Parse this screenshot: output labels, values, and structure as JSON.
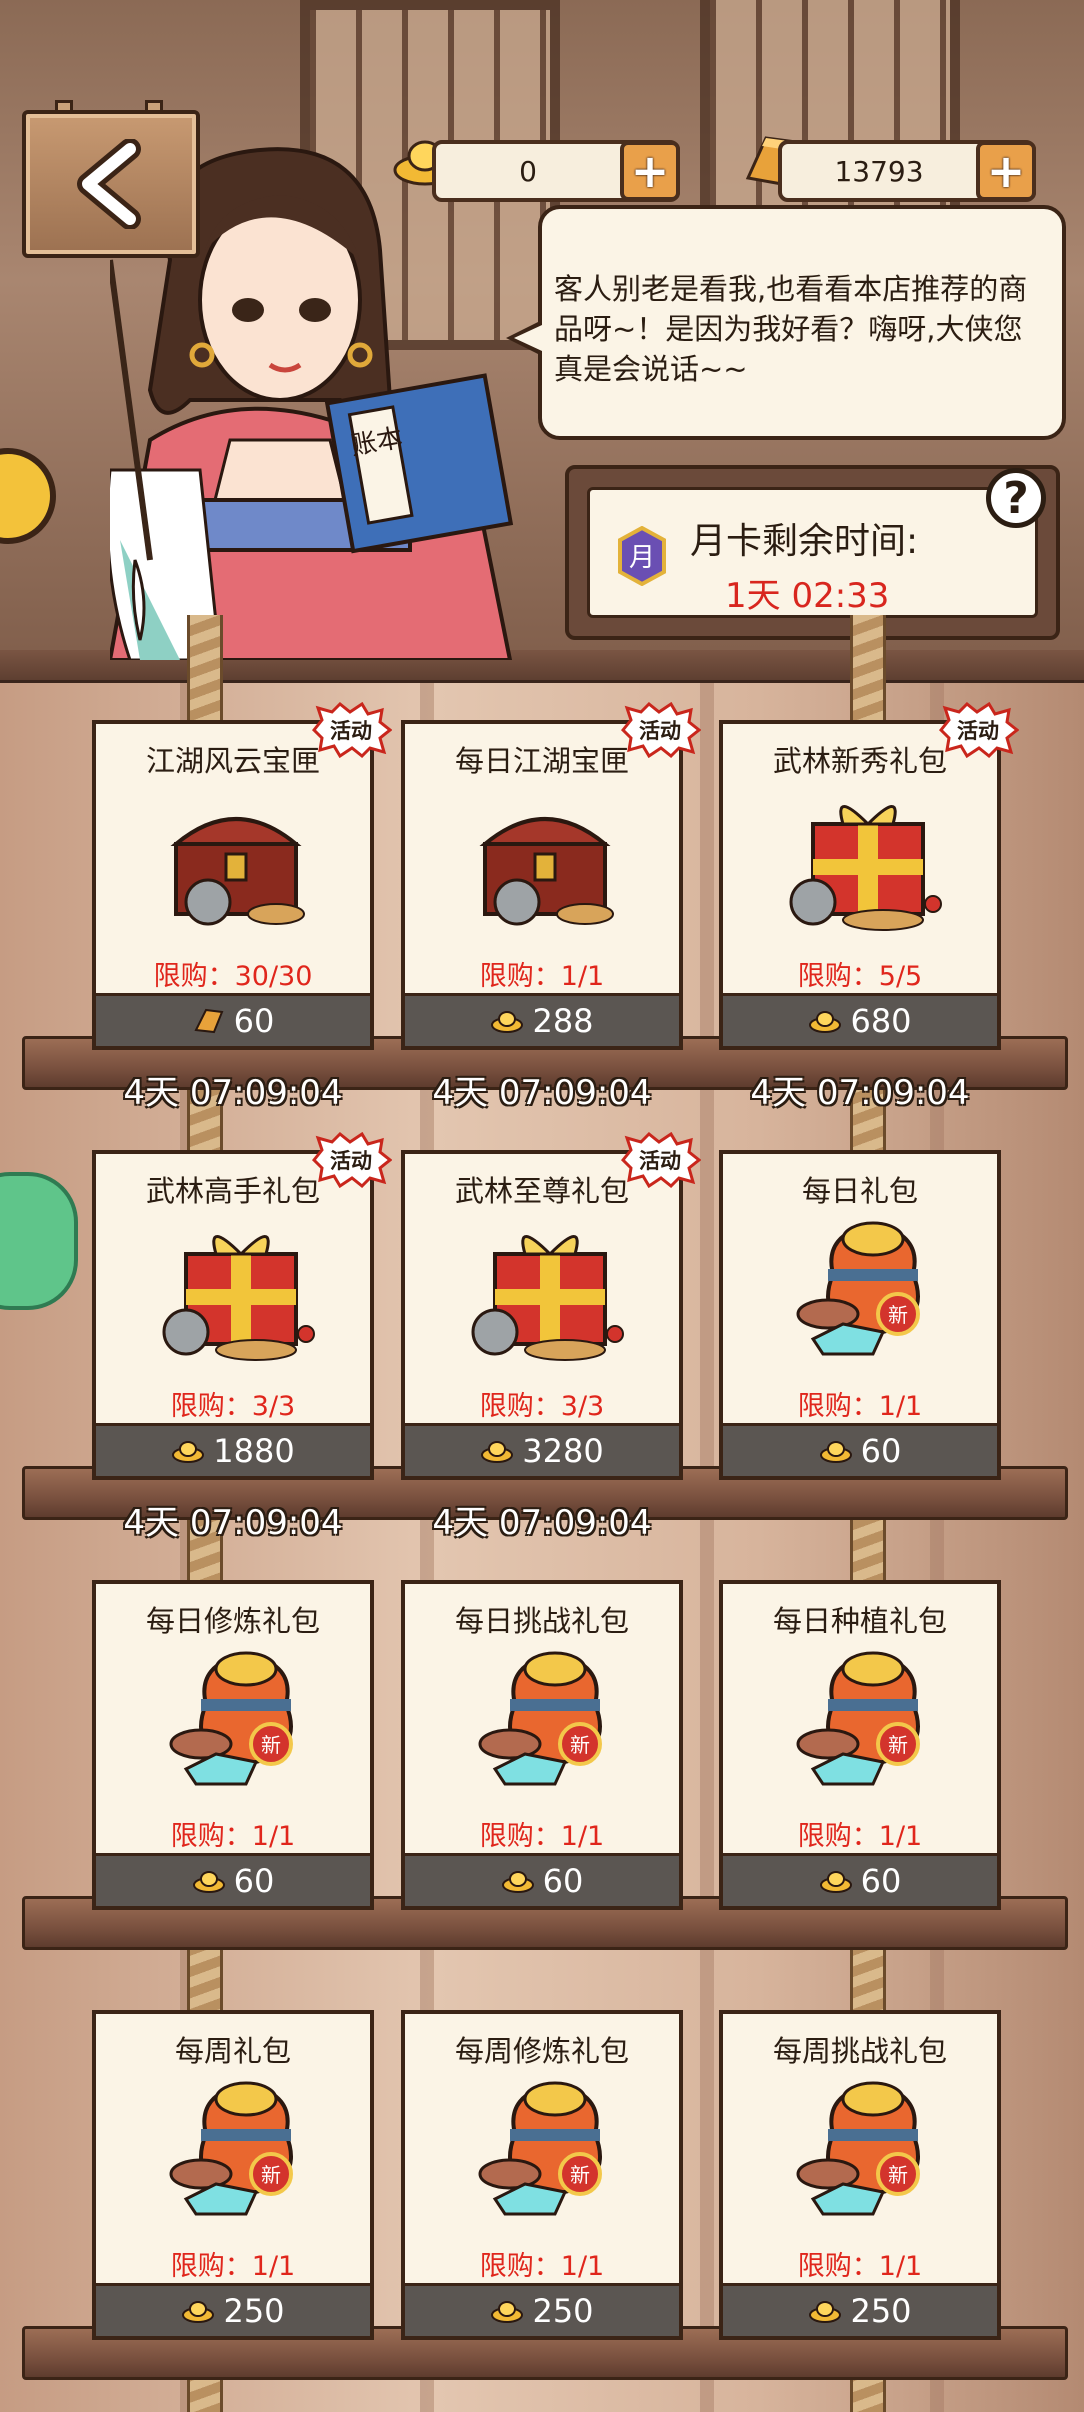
{
  "currencies": {
    "gold": {
      "value": "0",
      "icon": "gold-ingot-icon"
    },
    "bar": {
      "value": "13793",
      "icon": "gold-bar-icon"
    }
  },
  "speech": {
    "text": "客人别老是看我,也看看本店推荐的商品呀~！是因为我好看？嗨呀,大侠您真是会说话~~"
  },
  "month_card": {
    "label": "月卡剩余时间:",
    "time": "1天 02:33"
  },
  "help": {
    "label": "?"
  },
  "badge_text": "活动",
  "items": [
    {
      "name": "江湖风云宝匣",
      "limit": "限购：30/30",
      "price": "60",
      "currency": "bar",
      "timer": "4天 07:09:04",
      "badge": true,
      "art": "chest"
    },
    {
      "name": "每日江湖宝匣",
      "limit": "限购：1/1",
      "price": "288",
      "currency": "gold",
      "timer": "4天 07:09:04",
      "badge": true,
      "art": "chest"
    },
    {
      "name": "武林新秀礼包",
      "limit": "限购：5/5",
      "price": "680",
      "currency": "gold",
      "timer": "4天 07:09:04",
      "badge": true,
      "art": "giftbox"
    },
    {
      "name": "武林高手礼包",
      "limit": "限购：3/3",
      "price": "1880",
      "currency": "gold",
      "timer": "4天 07:09:04",
      "badge": true,
      "art": "giftbox"
    },
    {
      "name": "武林至尊礼包",
      "limit": "限购：3/3",
      "price": "3280",
      "currency": "gold",
      "timer": "4天 07:09:04",
      "badge": true,
      "art": "giftbox"
    },
    {
      "name": "每日礼包",
      "limit": "限购：1/1",
      "price": "60",
      "currency": "gold",
      "timer": "",
      "badge": false,
      "art": "bag"
    },
    {
      "name": "每日修炼礼包",
      "limit": "限购：1/1",
      "price": "60",
      "currency": "gold",
      "timer": "",
      "badge": false,
      "art": "bag"
    },
    {
      "name": "每日挑战礼包",
      "limit": "限购：1/1",
      "price": "60",
      "currency": "gold",
      "timer": "",
      "badge": false,
      "art": "bag"
    },
    {
      "name": "每日种植礼包",
      "limit": "限购：1/1",
      "price": "60",
      "currency": "gold",
      "timer": "",
      "badge": false,
      "art": "bag"
    },
    {
      "name": "每周礼包",
      "limit": "限购：1/1",
      "price": "250",
      "currency": "gold",
      "timer": "",
      "badge": false,
      "art": "bag"
    },
    {
      "name": "每周修炼礼包",
      "limit": "限购：1/1",
      "price": "250",
      "currency": "gold",
      "timer": "",
      "badge": false,
      "art": "bag"
    },
    {
      "name": "每周挑战礼包",
      "limit": "限购：1/1",
      "price": "250",
      "currency": "gold",
      "timer": "",
      "badge": false,
      "art": "bag"
    }
  ],
  "bag_badge_text": "新",
  "book_text": "账本"
}
